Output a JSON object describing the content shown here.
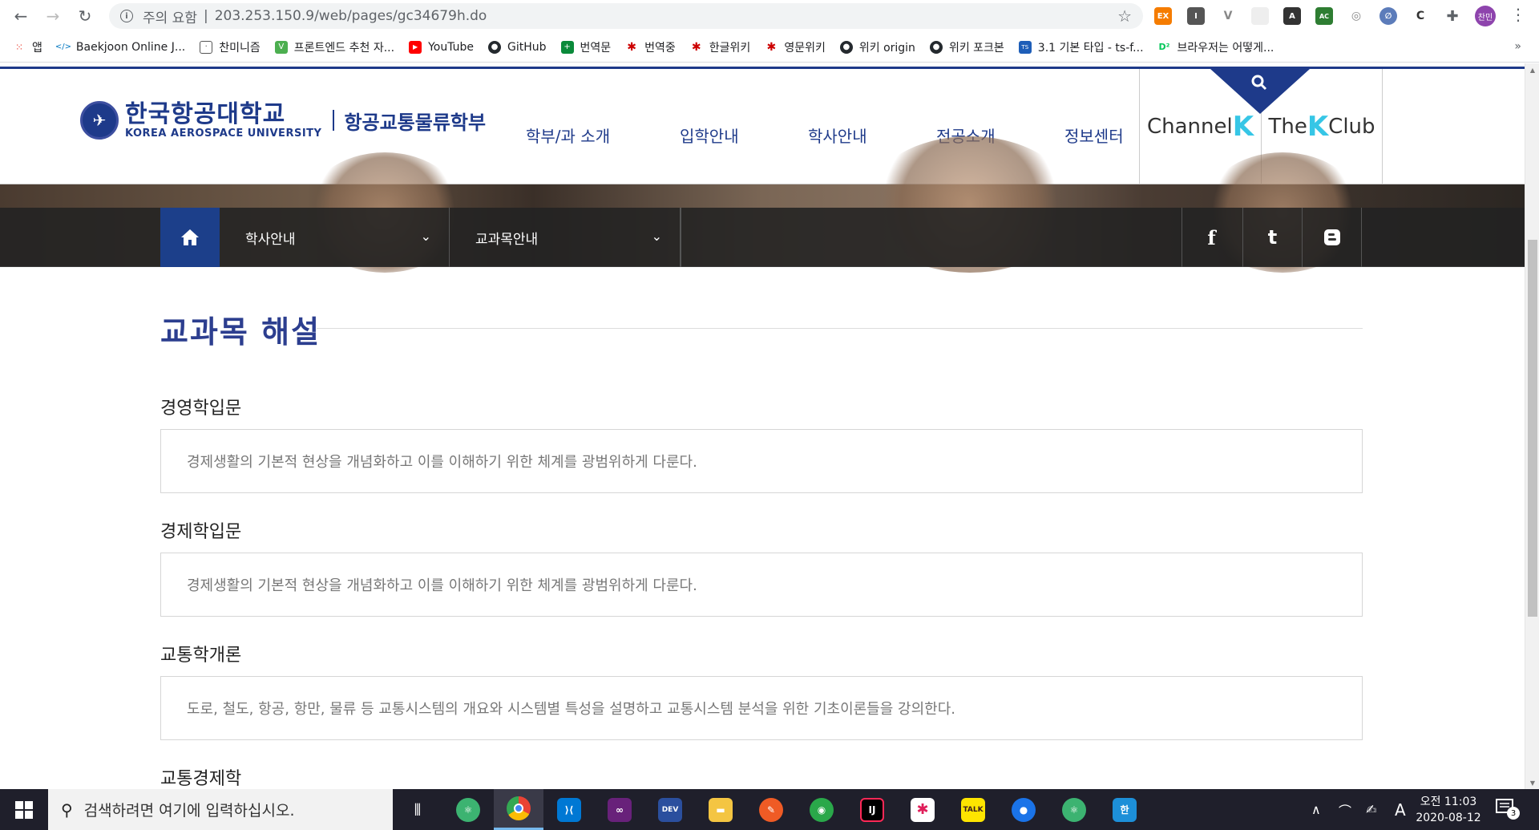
{
  "browser": {
    "security_label": "주의 요함",
    "separator": "|",
    "url": "203.253.150.9/web/pages/gc34679h.do",
    "profile_label": "찬민"
  },
  "bookmarks": [
    {
      "label": "앱",
      "color": "#ea4335",
      "glyph": "⋮⋮"
    },
    {
      "label": "Baekjoon Online J...",
      "color": "#0076c0",
      "glyph": "<>"
    },
    {
      "label": "찬미니즘",
      "color": "#555555",
      "glyph": "·"
    },
    {
      "label": "프론트엔드 추천 자...",
      "color": "#4caf50",
      "glyph": "V"
    },
    {
      "label": "YouTube",
      "color": "#ff0000",
      "glyph": "▶"
    },
    {
      "label": "GitHub",
      "color": "#24292e",
      "glyph": "●"
    },
    {
      "label": "번역문",
      "color": "#0a8a3a",
      "glyph": "+"
    },
    {
      "label": "번역중",
      "color": "#cc0000",
      "glyph": "✱"
    },
    {
      "label": "한글위키",
      "color": "#cc0000",
      "glyph": "✱"
    },
    {
      "label": "영문위키",
      "color": "#cc0000",
      "glyph": "✱"
    },
    {
      "label": "위키 origin",
      "color": "#24292e",
      "glyph": "●"
    },
    {
      "label": "위키 포크본",
      "color": "#24292e",
      "glyph": "●"
    },
    {
      "label": "3.1 기본 타입 - ts-f...",
      "color": "#1e5eb8",
      "glyph": "TS"
    },
    {
      "label": "브라우저는 어떻게...",
      "color": "#03c75a",
      "glyph": "D²"
    }
  ],
  "header": {
    "logo_ko": "한국항공대학교",
    "logo_en": "KOREA AEROSPACE UNIVERSITY",
    "department": "항공교통물류학부",
    "nav": [
      "학부/과 소개",
      "입학안내",
      "학사안내",
      "전공소개",
      "정보센터"
    ],
    "quick1_prefix": "Channel",
    "quick1_k": "K",
    "quick2_prefix": "The",
    "quick2_k": "K",
    "quick2_suffix": "Club"
  },
  "subnav": {
    "level1": "학사안내",
    "level2": "교과목안내",
    "social": [
      "facebook-icon",
      "twitter-icon",
      "blog-icon"
    ]
  },
  "main": {
    "title": "교과목 해설",
    "courses": [
      {
        "name": "경영학입문",
        "desc": "경제생활의 기본적 현상을 개념화하고 이를 이해하기 위한 체계를 광범위하게 다룬다."
      },
      {
        "name": "경제학입문",
        "desc": "경제생활의 기본적 현상을 개념화하고 이를 이해하기 위한 체계를 광범위하게 다룬다."
      },
      {
        "name": "교통학개론",
        "desc": "도로, 철도, 항공, 항만, 물류 등 교통시스템의 개요와 시스템별 특성을 설명하고 교통시스템 분석을 위한 기초이론들을 강의한다."
      },
      {
        "name": "교통경제학",
        "desc": ""
      }
    ]
  },
  "taskbar": {
    "search_placeholder": "검색하려면 여기에 입력하십시오.",
    "time": "오전 11:03",
    "date": "2020-08-12",
    "ime": "A",
    "notif_count": "3"
  },
  "colors": {
    "brand": "#1e3a8a",
    "accent_k": "#36c6e6",
    "home_button": "#1c3f8a"
  }
}
